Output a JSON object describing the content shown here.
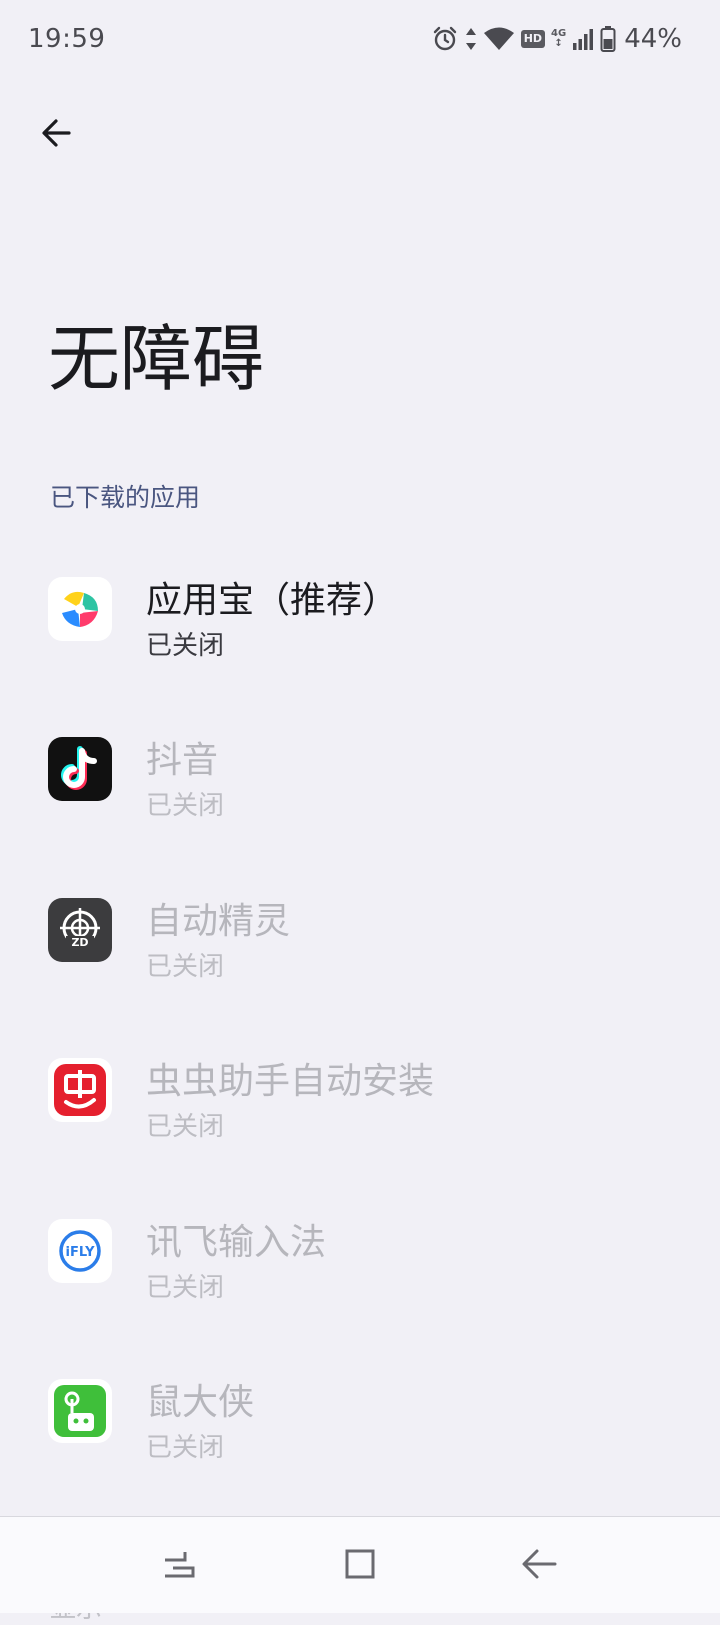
{
  "status_bar": {
    "time": "19:59",
    "hd_label": "HD",
    "network_label": "4G",
    "battery_percent": "44%",
    "icons": [
      "alarm-icon",
      "data-arrows-icon",
      "wifi-icon",
      "hd-badge",
      "signal-icon",
      "battery-icon"
    ]
  },
  "header": {
    "back_icon": "arrow-left-icon",
    "title": "无障碍"
  },
  "section": {
    "title": "已下载的应用"
  },
  "apps": [
    {
      "name": "应用宝（推荐）",
      "status": "已关闭",
      "icon": "yingyongbao-icon",
      "enabled": true
    },
    {
      "name": "抖音",
      "status": "已关闭",
      "icon": "douyin-icon",
      "enabled": false
    },
    {
      "name": "自动精灵",
      "status": "已关闭",
      "icon": "zidongjingling-icon",
      "enabled": false
    },
    {
      "name": "虫虫助手自动安装",
      "status": "已关闭",
      "icon": "chongchong-icon",
      "enabled": false
    },
    {
      "name": "讯飞输入法",
      "status": "已关闭",
      "icon": "ifly-icon",
      "enabled": false
    },
    {
      "name": "鼠大侠",
      "status": "已关闭",
      "icon": "shudaxia-icon",
      "enabled": false
    }
  ],
  "next_section_peek": "显示",
  "nav_bar": {
    "buttons": [
      "recents-button",
      "home-button",
      "back-button"
    ]
  },
  "colors": {
    "background": "#f1f0f6",
    "section_header": "#4a5680",
    "disabled_text": "#b6b6bc"
  }
}
